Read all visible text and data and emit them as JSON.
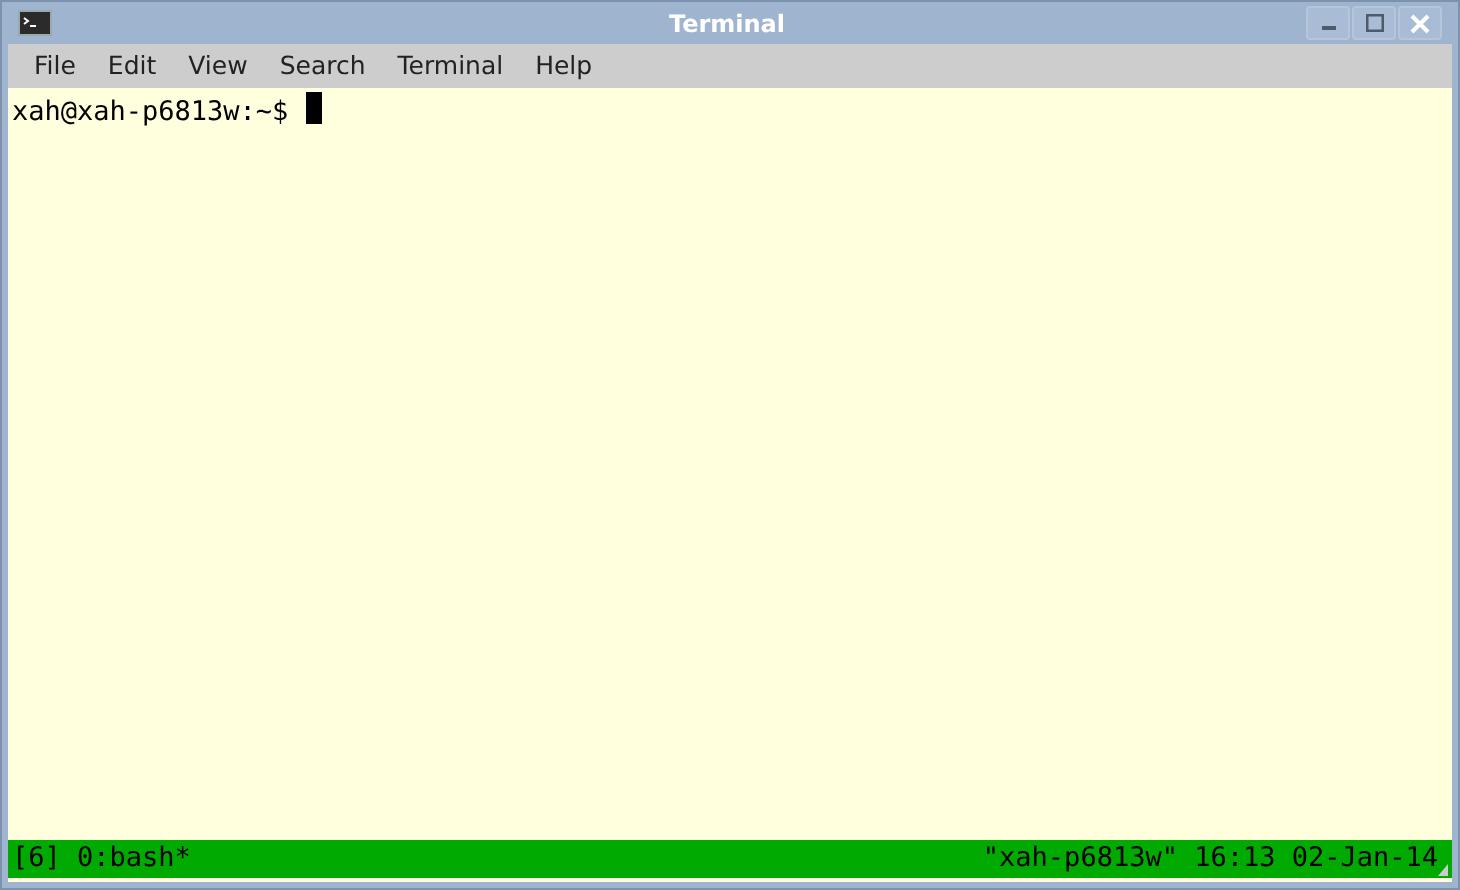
{
  "window": {
    "title": "Terminal"
  },
  "menu": [
    "File",
    "Edit",
    "View",
    "Search",
    "Terminal",
    "Help"
  ],
  "terminal": {
    "prompt": "xah@xah-p6813w:~$"
  },
  "status_bar": {
    "left": "[6] 0:bash*",
    "right": "\"xah-p6813w\" 16:13 02-Jan-14"
  }
}
